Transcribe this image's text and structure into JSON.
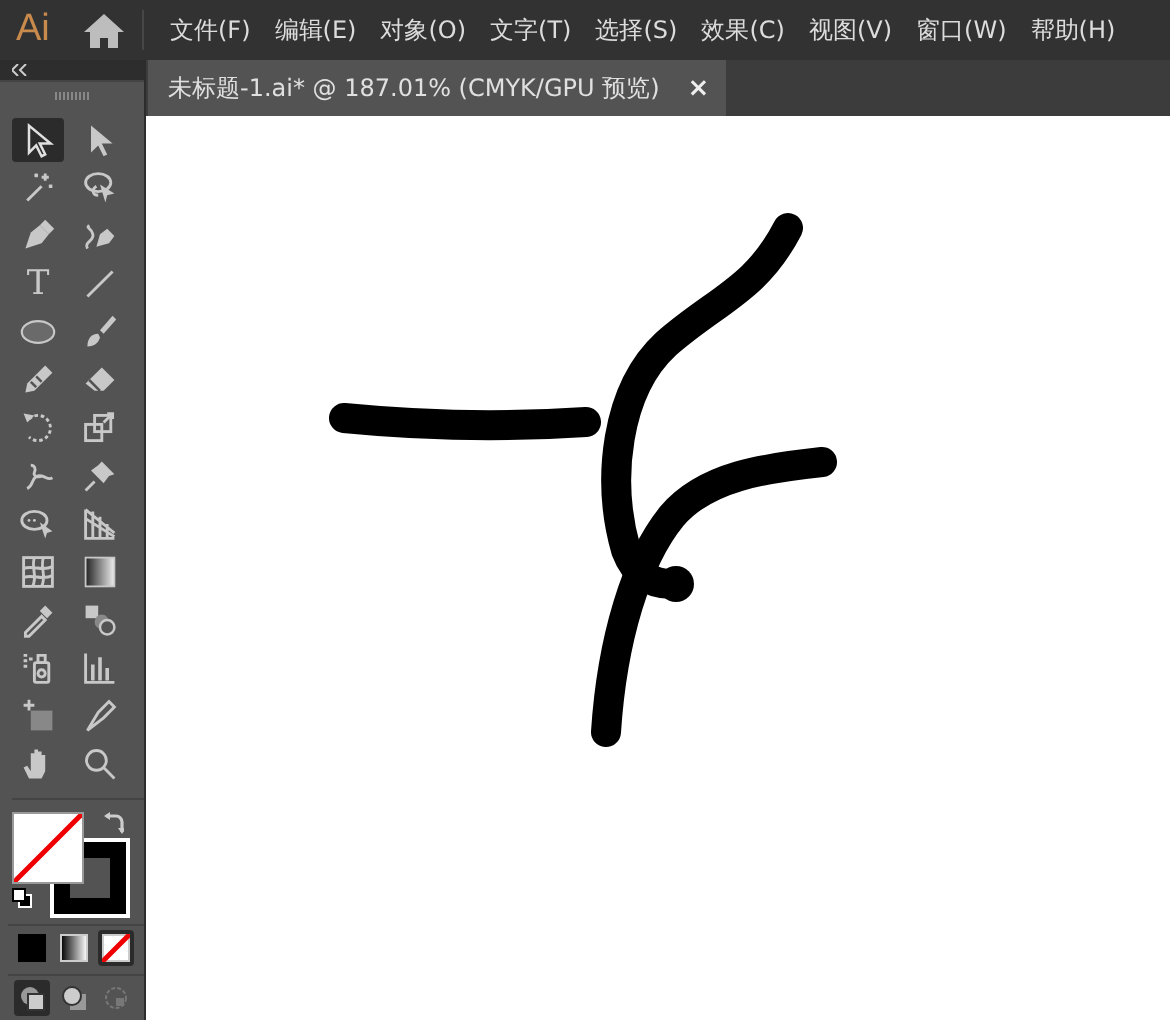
{
  "app": {
    "logo": "Ai"
  },
  "menu": [
    "文件(F)",
    "编辑(E)",
    "对象(O)",
    "文字(T)",
    "选择(S)",
    "效果(C)",
    "视图(V)",
    "窗口(W)",
    "帮助(H)"
  ],
  "document_tab": {
    "title": "未标题-1.ai* @ 187.01% (CMYK/GPU 预览)",
    "close": "×"
  },
  "tools": [
    {
      "kind": "selection",
      "selected": true
    },
    {
      "kind": "direct",
      "selected": false
    },
    {
      "kind": "wand",
      "selected": false
    },
    {
      "kind": "lasso",
      "selected": false
    },
    {
      "kind": "pen",
      "selected": false
    },
    {
      "kind": "curvature",
      "selected": false
    },
    {
      "kind": "type",
      "label": "T",
      "selected": false
    },
    {
      "kind": "line",
      "selected": false
    },
    {
      "kind": "ellipse",
      "selected": false
    },
    {
      "kind": "brush",
      "selected": false
    },
    {
      "kind": "shaper",
      "selected": false
    },
    {
      "kind": "eraser",
      "selected": false
    },
    {
      "kind": "rotate",
      "selected": false
    },
    {
      "kind": "scale",
      "selected": false
    },
    {
      "kind": "puppet",
      "selected": false
    },
    {
      "kind": "pin",
      "selected": false
    },
    {
      "kind": "shapebuilder",
      "selected": false
    },
    {
      "kind": "perspective",
      "selected": false
    },
    {
      "kind": "mesh",
      "selected": false
    },
    {
      "kind": "gradient",
      "selected": false
    },
    {
      "kind": "eyedropper",
      "selected": false
    },
    {
      "kind": "blend",
      "selected": false
    },
    {
      "kind": "sprayer",
      "selected": false
    },
    {
      "kind": "graph",
      "selected": false
    },
    {
      "kind": "artboard",
      "selected": false
    },
    {
      "kind": "knife",
      "selected": false
    },
    {
      "kind": "hand",
      "selected": false
    },
    {
      "kind": "zoom",
      "selected": false
    }
  ],
  "color_modes": [
    {
      "kind": "color",
      "selected": false
    },
    {
      "kind": "gradient",
      "selected": false
    },
    {
      "kind": "none",
      "selected": true
    }
  ],
  "draw_modes": [
    {
      "kind": "normal",
      "selected": true
    },
    {
      "kind": "behind",
      "selected": false
    },
    {
      "kind": "inside",
      "selected": false
    }
  ]
}
